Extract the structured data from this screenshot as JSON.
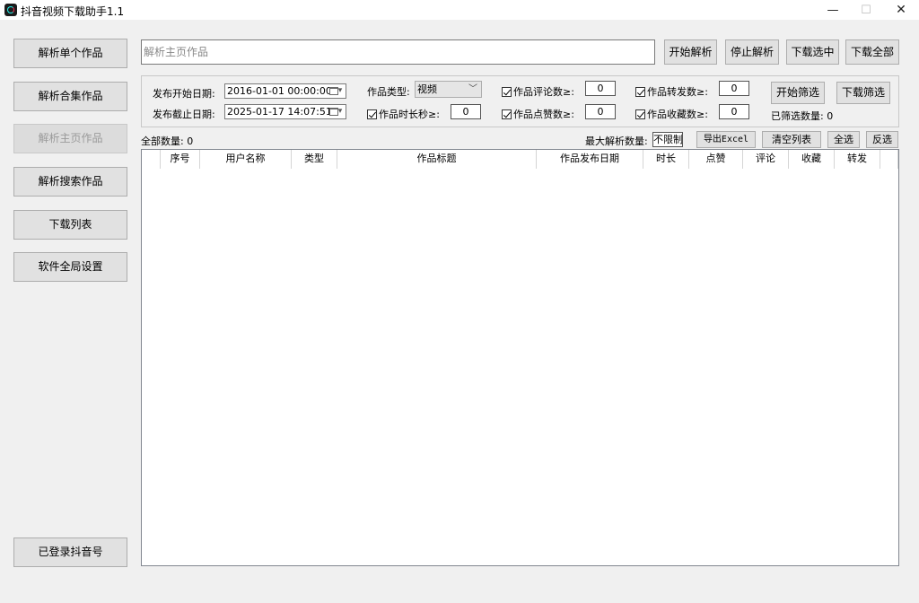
{
  "window": {
    "title": "抖音视频下载助手1.1",
    "min": "—",
    "max": "☐",
    "close": "✕"
  },
  "sidebar": {
    "items": [
      {
        "label": "解析单个作品"
      },
      {
        "label": "解析合集作品"
      },
      {
        "label": "解析主页作品"
      },
      {
        "label": "解析搜索作品"
      },
      {
        "label": "下载列表"
      },
      {
        "label": "软件全局设置"
      }
    ],
    "account_label": "已登录抖音号"
  },
  "toolbar": {
    "url_placeholder": "解析主页作品",
    "start_parse": "开始解析",
    "stop_parse": "停止解析",
    "download_selected": "下载选中",
    "download_all": "下载全部"
  },
  "filters": {
    "start_date_label": "发布开始日期:",
    "start_date_value": "2016-01-01 00:00:00",
    "end_date_label": "发布截止日期:",
    "end_date_value": "2025-01-17 14:07:51",
    "type_label": "作品类型:",
    "type_value": "视频",
    "duration_label": "作品时长秒≥:",
    "duration_value": "0",
    "comments_label": "作品评论数≥:",
    "comments_value": "0",
    "likes_label": "作品点赞数≥:",
    "likes_value": "0",
    "shares_label": "作品转发数≥:",
    "shares_value": "0",
    "favorites_label": "作品收藏数≥:",
    "favorites_value": "0",
    "start_filter": "开始筛选",
    "download_filter": "下载筛选",
    "filtered_count_label": "已筛选数量:",
    "filtered_count": "0"
  },
  "list_toolbar": {
    "total_label": "全部数量:",
    "total_count": "0",
    "max_parse_label": "最大解析数量:",
    "max_parse_value": "不限制",
    "export_excel": "导出Excel",
    "clear_list": "清空列表",
    "select_all": "全选",
    "invert_select": "反选"
  },
  "table": {
    "columns": [
      "",
      "序号",
      "用户名称",
      "类型",
      "作品标题",
      "作品发布日期",
      "时长",
      "点赞",
      "评论",
      "收藏",
      "转发",
      ""
    ],
    "rows": []
  }
}
